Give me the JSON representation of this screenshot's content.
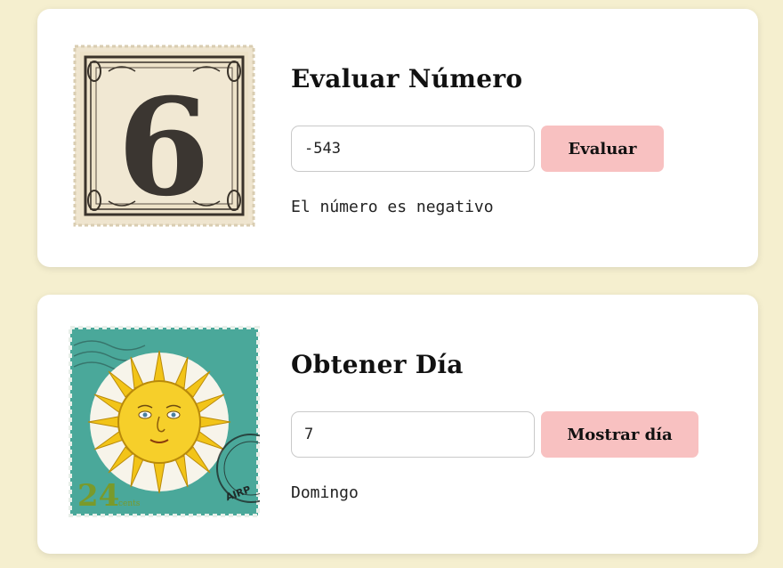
{
  "evaluar": {
    "title": "Evaluar Número",
    "input_value": "-543",
    "button_label": "Evaluar",
    "result": "El número es negativo",
    "stamp_number": "6"
  },
  "dia": {
    "title": "Obtener Día",
    "input_value": "7",
    "button_label": "Mostrar día",
    "result": "Domingo",
    "stamp_value": "24",
    "stamp_unit": "cents",
    "postmark_text": "AIRP"
  },
  "colors": {
    "page_bg": "#f5efcf",
    "card_bg": "#ffffff",
    "button_bg": "#f8c1c1",
    "stamp_teal": "#4aa89a",
    "sun_yellow": "#f2c418"
  },
  "icons": {
    "stamp1": "number-six-stamp-image",
    "stamp2": "sun-stamp-image"
  }
}
